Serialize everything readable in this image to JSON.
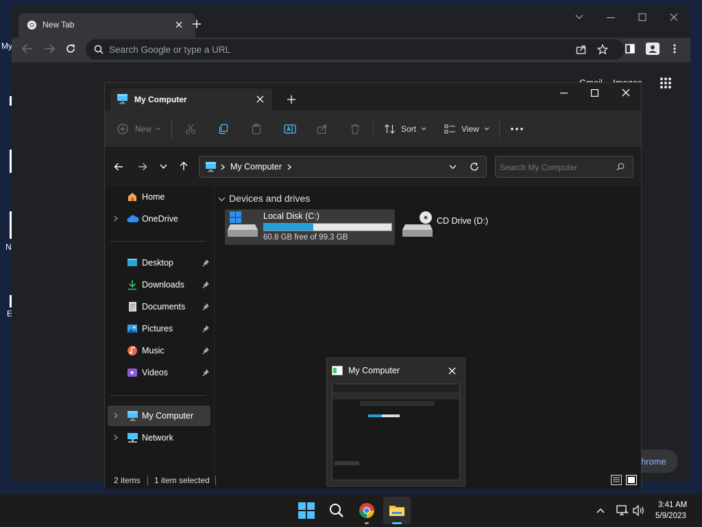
{
  "desktop": {
    "icon_labels": [
      "My",
      "N",
      "E"
    ]
  },
  "chrome": {
    "tab_title": "New Tab",
    "omnibox_placeholder": "Search Google or type a URL",
    "top_links": [
      "Gmail",
      "Images"
    ],
    "customize_label": "hrome"
  },
  "explorer": {
    "tab_title": "My Computer",
    "toolbar": {
      "new_label": "New",
      "sort_label": "Sort",
      "view_label": "View"
    },
    "address": {
      "location": "My Computer"
    },
    "search_placeholder": "Search My Computer",
    "sidebar": {
      "top": [
        {
          "label": "Home",
          "icon": "home-icon"
        },
        {
          "label": "OneDrive",
          "icon": "onedrive-icon"
        }
      ],
      "quick_access": [
        {
          "label": "Desktop",
          "icon": "desktop-folder-icon"
        },
        {
          "label": "Downloads",
          "icon": "downloads-icon"
        },
        {
          "label": "Documents",
          "icon": "documents-icon"
        },
        {
          "label": "Pictures",
          "icon": "pictures-icon"
        },
        {
          "label": "Music",
          "icon": "music-icon"
        },
        {
          "label": "Videos",
          "icon": "videos-icon"
        }
      ],
      "bottom": [
        {
          "label": "My Computer",
          "icon": "computer-icon",
          "selected": true
        },
        {
          "label": "Network",
          "icon": "network-icon"
        }
      ]
    },
    "section_title": "Devices and drives",
    "drives": [
      {
        "name": "Local Disk (C:)",
        "free_text": "60.8 GB free of 99.3 GB",
        "used_fraction": 0.388
      },
      {
        "name": "CD Drive (D:)"
      }
    ],
    "status": {
      "items": "2 items",
      "selected": "1 item selected"
    }
  },
  "preview": {
    "title": "My Computer"
  },
  "taskbar": {
    "time": "3:41 AM",
    "date": "5/9/2023"
  },
  "colors": {
    "accent": "#0078d4",
    "drive_bar": "#26a0da",
    "selected_bg": "#3a3a3a"
  }
}
